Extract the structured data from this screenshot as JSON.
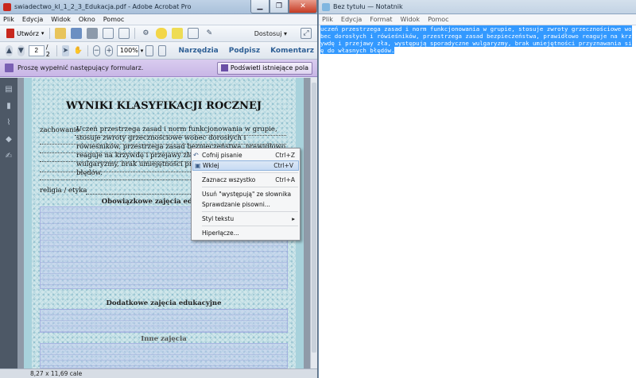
{
  "acrobat": {
    "title": "swiadectwo_kl_1_2_3_Edukacja.pdf - Adobe Acrobat Pro",
    "menu": [
      "Plik",
      "Edycja",
      "Widok",
      "Okno",
      "Pomoc"
    ],
    "create_label": "Utwórz",
    "customize_label": "Dostosuj",
    "page_current": "2",
    "page_total": "/ 2",
    "zoom": "100%",
    "panes": [
      "Narzędzia",
      "Podpisz",
      "Komentarz"
    ],
    "form_message": "Proszę wypełnić następujący formularz.",
    "highlight_label": "Podświetl istniejące pola",
    "doc": {
      "title": "WYNIKI KLASYFIKACJI ROCZNEJ",
      "behavior_label": "zachowanie",
      "behavior_text": "Uczeń przestrzega zasad i norm funkcjonowania w grupie, stosuje zwroty grzecznościowe wobec dorosłych i rówieśników, przestrzega zasad bezpieczeństwa, prawidłowo reaguje na krzywdę i przejawy zła, występują sporadyczne wulgaryzmy, brak umiejętności przyznawania się do własnych błędów.",
      "religion_label": "religia / etyka",
      "section_mandatory": "Obowiązkowe zajęcia edukacyjne",
      "section_additional": "Dodatkowe zajęcia edukacyjne",
      "section_other": "Inne zajęcia"
    },
    "status_size": "8,27 x 11,69 cale"
  },
  "context_menu": {
    "items": [
      {
        "label": "Cofnij pisanie",
        "shortcut": "Ctrl+Z",
        "icon": "undo-icon"
      },
      {
        "label": "Wklej",
        "shortcut": "Ctrl+V",
        "icon": "paste-icon"
      },
      {
        "label": "Zaznacz wszystko",
        "shortcut": "Ctrl+A"
      },
      {
        "label": "Usuń \"występują\" ze słownika",
        "shortcut": ""
      },
      {
        "label": "Sprawdzanie pisowni...",
        "shortcut": ""
      },
      {
        "label": "Styl tekstu",
        "shortcut": ""
      },
      {
        "label": "Hiperłącze...",
        "shortcut": ""
      }
    ]
  },
  "notepad": {
    "title": "Bez tytułu — Notatnik",
    "menu": [
      "Plik",
      "Edycja",
      "Format",
      "Widok",
      "Pomoc"
    ],
    "text": "uczeń przestrzega zasad i norm funkcjonowania w grupie, stosuje zwroty grzecznościowe wobec dorosłych i rówieśników, przestrzega zasad bezpieczeństwa, prawidłowo reaguje na krzywdę i przejawy zła, występują sporadyczne wulgaryzmy, brak umiejętności przyznawania się do własnych błędów."
  },
  "colors": {
    "selection": "#3399ff",
    "form_bar": "#c8b6e6",
    "panel_link": "#2e5f95"
  }
}
